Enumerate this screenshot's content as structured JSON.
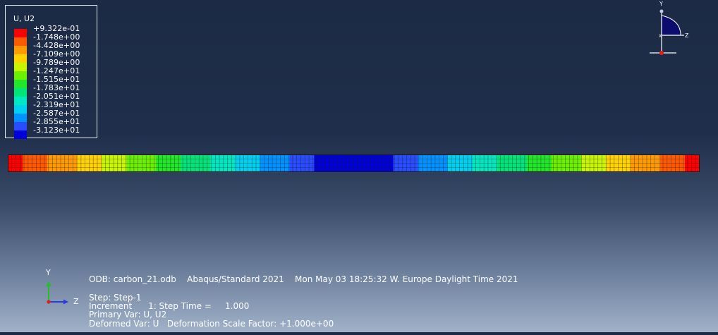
{
  "legend": {
    "title": "U, U2",
    "entries": [
      {
        "label": "+9.322e-01",
        "color": "#ff0000"
      },
      {
        "label": "-1.748e+00",
        "color": "#ff5a00"
      },
      {
        "label": "-4.428e+00",
        "color": "#ff9a00"
      },
      {
        "label": "-7.109e+00",
        "color": "#ffd200"
      },
      {
        "label": "-9.789e+00",
        "color": "#c8f500"
      },
      {
        "label": "-1.247e+01",
        "color": "#6cf000"
      },
      {
        "label": "-1.515e+01",
        "color": "#22e62a"
      },
      {
        "label": "-1.783e+01",
        "color": "#00e47a"
      },
      {
        "label": "-2.051e+01",
        "color": "#00e8c2"
      },
      {
        "label": "-2.319e+01",
        "color": "#00d0f0"
      },
      {
        "label": "-2.587e+01",
        "color": "#0092ff"
      },
      {
        "label": "-2.855e+01",
        "color": "#2a4cff"
      },
      {
        "label": "-3.123e+01",
        "color": "#0000d8"
      }
    ]
  },
  "triad_top": {
    "y_label": "Y",
    "z_label": "Z",
    "x_label": "X"
  },
  "triad_bottom": {
    "y_label": "Y",
    "z_label": "Z"
  },
  "info": {
    "odb_line": "ODB: carbon_21.odb    Abaqus/Standard 2021    Mon May 03 18:25:32 W. Europe Daylight Time 2021",
    "step_line": "Step: Step-1",
    "increment_line": "Increment      1: Step Time =     1.000",
    "primary_line": "Primary Var: U, U2",
    "deformed_line": "Deformed Var: U   Deformation Scale Factor: +1.000e+00"
  },
  "colors": {
    "background_top": "#1c2a45",
    "background_bottom": "#a0b1c8",
    "mesh_line": "#1a1a1a"
  }
}
